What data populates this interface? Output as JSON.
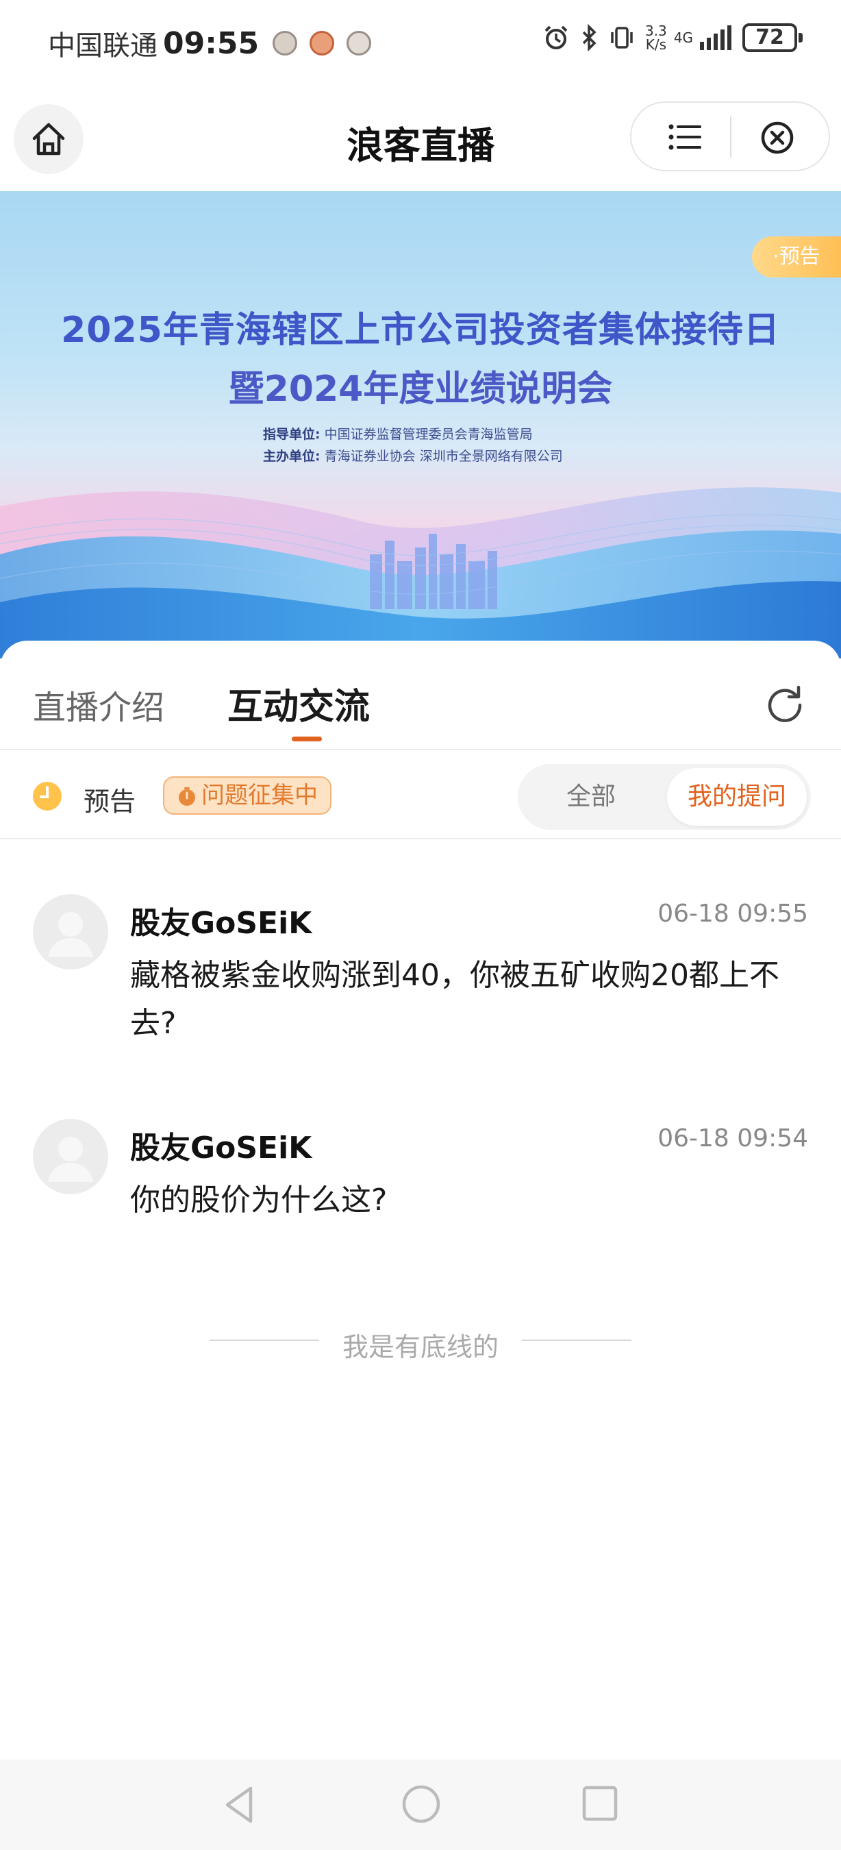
{
  "status_bar": {
    "carrier": "中国联通",
    "time": "09:55",
    "net_speed_value": "3.3",
    "net_speed_unit": "K/s",
    "network": "4G",
    "battery": "72"
  },
  "nav": {
    "title": "浪客直播"
  },
  "banner": {
    "badge": "·预告",
    "title_line1": "2025年青海辖区上市公司投资者集体接待日",
    "title_line2": "暨2024年度业绩说明会",
    "guide_label": "指导单位:",
    "guide_value": "中国证券监督管理委员会青海监管局",
    "host_label": "主办单位:",
    "host_value": "青海证券业协会 深圳市全景网络有限公司"
  },
  "tabs": {
    "intro": "直播介绍",
    "chat": "互动交流"
  },
  "status_row": {
    "status": "预告",
    "badge": "问题征集中",
    "filter_all": "全部",
    "filter_mine": "我的提问"
  },
  "messages": [
    {
      "name": "股友GoSEiK",
      "time": "06-18 09:55",
      "text": "藏格被紫金收购涨到40，你被五矿收购20都上不去?"
    },
    {
      "name": "股友GoSEiK",
      "time": "06-18 09:54",
      "text": "你的股价为什么这?"
    }
  ],
  "footer": {
    "text": "我是有底线的"
  },
  "colors": {
    "accent": "#e0621e",
    "badge_bg": "#fde2c4",
    "badge_text": "#e27a2c",
    "banner_title": "#3d56c8"
  },
  "icons": [
    "home-icon",
    "menu-icon",
    "close-icon",
    "refresh-icon",
    "clock-icon",
    "timer-icon",
    "avatar-placeholder-icon",
    "back-nav-icon",
    "home-nav-icon",
    "recent-nav-icon"
  ]
}
